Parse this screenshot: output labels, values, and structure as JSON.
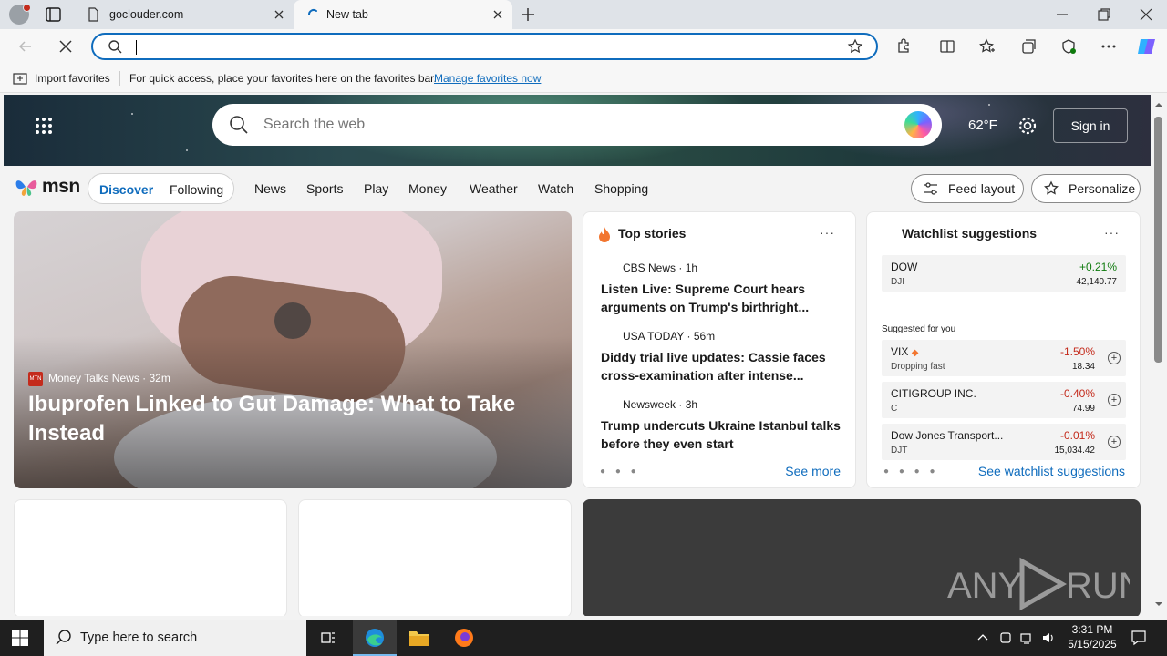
{
  "browser": {
    "tabs": [
      {
        "title": "goclouder.com",
        "active": false
      },
      {
        "title": "New tab",
        "active": true
      }
    ],
    "address": {
      "value": "",
      "placeholder": ""
    },
    "favorites_bar": {
      "import_label": "Import favorites",
      "message": "For quick access, place your favorites here on the favorites bar.",
      "manage_link": "Manage favorites now"
    }
  },
  "msn": {
    "search_placeholder": "Search the web",
    "weather": "62°F",
    "sign_in": "Sign in",
    "logo_text": "msn",
    "feed_tabs": [
      "Discover",
      "Following"
    ],
    "categories": [
      "News",
      "Sports",
      "Play",
      "Money",
      "Weather",
      "Watch",
      "Shopping"
    ],
    "feed_layout": "Feed layout",
    "personalize": "Personalize",
    "main_story": {
      "source": "Money Talks News",
      "source_badge": "MTN",
      "age": "32m",
      "title": "Ibuprofen Linked to Gut Damage: What to Take Instead"
    },
    "top_stories": {
      "header": "Top stories",
      "more": "···",
      "items": [
        {
          "source": "CBS News",
          "age": "1h",
          "headline": "Listen Live: Supreme Court hears arguments on Trump's birthright..."
        },
        {
          "source": "USA TODAY",
          "age": "56m",
          "headline": "Diddy trial live updates: Cassie faces cross-examination after intense..."
        },
        {
          "source": "Newsweek",
          "age": "3h",
          "headline": "Trump undercuts Ukraine Istanbul talks before they even start"
        }
      ],
      "see_more": "See more",
      "pager": "● ● ●"
    },
    "watchlist": {
      "header": "Watchlist suggestions",
      "more": "···",
      "primary": {
        "name": "DOW",
        "ticker": "DJI",
        "change": "+0.21%",
        "price": "42,140.77"
      },
      "suggested_label": "Suggested for you",
      "suggested": [
        {
          "name": "VIX",
          "ticker": "Dropping fast",
          "change": "-1.50%",
          "price": "18.34"
        },
        {
          "name": "CITIGROUP INC.",
          "ticker": "C",
          "change": "-0.40%",
          "price": "74.99"
        },
        {
          "name": "Dow Jones Transport...",
          "ticker": "DJT",
          "change": "-0.01%",
          "price": "15,034.42"
        }
      ],
      "see_link": "See watchlist suggestions",
      "pager": "● ● ● ●",
      "colors": {
        "up": "#0e7a0d",
        "down": "#c42b1c"
      }
    },
    "watermark": "ANY RUN"
  },
  "taskbar": {
    "search_placeholder": "Type here to search",
    "time": "3:31 PM",
    "date": "5/15/2025"
  },
  "colors": {
    "accent": "#0f6cbd"
  }
}
